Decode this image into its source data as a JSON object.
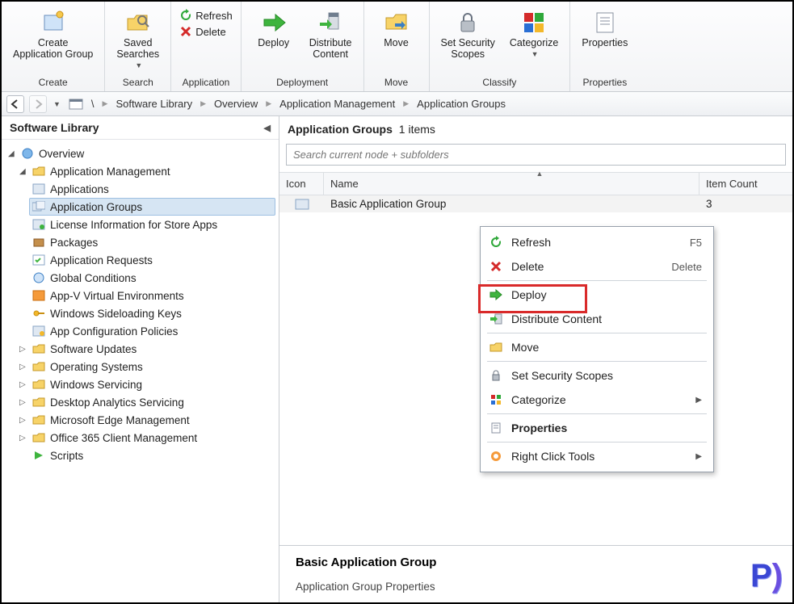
{
  "ribbon": {
    "create_app_group": "Create\nApplication Group",
    "saved_searches": "Saved\nSearches",
    "refresh": "Refresh",
    "delete": "Delete",
    "deploy": "Deploy",
    "distribute_content": "Distribute\nContent",
    "move": "Move",
    "set_security_scopes": "Set Security\nScopes",
    "categorize": "Categorize",
    "properties": "Properties",
    "group_create": "Create",
    "group_search": "Search",
    "group_application": "Application",
    "group_deployment": "Deployment",
    "group_move": "Move",
    "group_classify": "Classify",
    "group_properties": "Properties"
  },
  "breadcrumb": {
    "root": "\\",
    "items": [
      "Software Library",
      "Overview",
      "Application Management",
      "Application Groups"
    ]
  },
  "sidebar": {
    "title": "Software Library",
    "overview": "Overview",
    "app_mgmt": "Application Management",
    "children": {
      "applications": "Applications",
      "app_groups": "Application Groups",
      "license_info": "License Information for Store Apps",
      "packages": "Packages",
      "app_requests": "Application Requests",
      "global_conditions": "Global Conditions",
      "appv": "App-V Virtual Environments",
      "sideloading": "Windows Sideloading Keys",
      "app_config": "App Configuration Policies"
    },
    "software_updates": "Software Updates",
    "operating_systems": "Operating Systems",
    "windows_servicing": "Windows Servicing",
    "desktop_analytics": "Desktop Analytics Servicing",
    "edge_mgmt": "Microsoft Edge Management",
    "o365": "Office 365 Client Management",
    "scripts": "Scripts"
  },
  "main": {
    "title_prefix": "Application Groups",
    "count_text": "1 items",
    "search_placeholder": "Search current node + subfolders",
    "cols": {
      "icon": "Icon",
      "name": "Name",
      "item_count": "Item Count"
    },
    "rows": [
      {
        "name": "Basic Application Group",
        "count": "3"
      }
    ],
    "details_title": "Basic Application Group",
    "details_sub": "Application Group Properties"
  },
  "context_menu": {
    "refresh": {
      "label": "Refresh",
      "shortcut": "F5"
    },
    "delete": {
      "label": "Delete",
      "shortcut": "Delete"
    },
    "deploy": {
      "label": "Deploy"
    },
    "distribute": {
      "label": "Distribute Content"
    },
    "move": {
      "label": "Move"
    },
    "scopes": {
      "label": "Set Security Scopes"
    },
    "categorize": {
      "label": "Categorize"
    },
    "properties": {
      "label": "Properties"
    },
    "rct": {
      "label": "Right Click Tools"
    }
  }
}
